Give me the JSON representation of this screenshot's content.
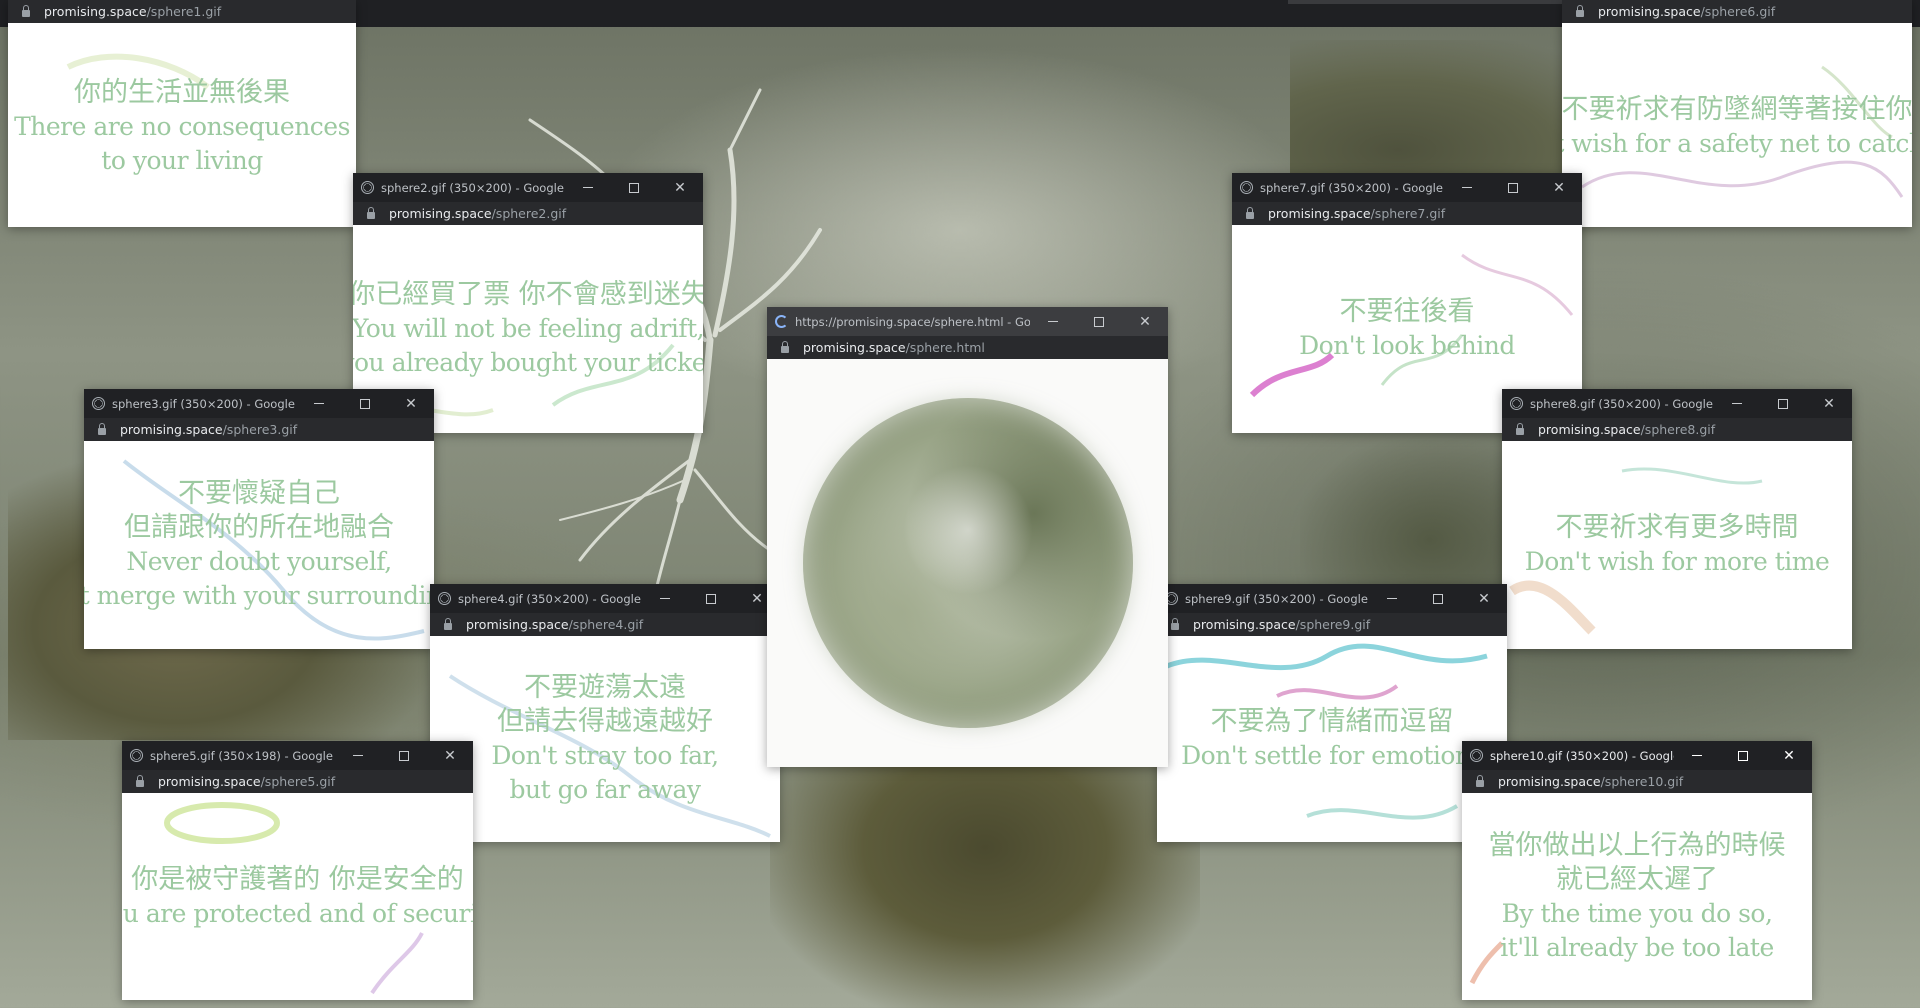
{
  "windows": [
    {
      "id": "sphere1",
      "title": "",
      "url_host": "promising.space",
      "url_path": "/sphere1.gif",
      "lines": [
        "你的生活並無後果",
        "There are no consequences",
        "to your living"
      ]
    },
    {
      "id": "sphere6",
      "title": "",
      "url_host": "promising.space",
      "url_path": "/sphere6.gif",
      "lines": [
        "不要祈求有防墜網等著接住你",
        "Don't wish for a safety net to catch you"
      ]
    },
    {
      "id": "sphere2",
      "title": "sphere2.gif (350×200) - Google C...",
      "url_host": "promising.space",
      "url_path": "/sphere2.gif",
      "lines": [
        "你已經買了票 你不會感到迷失",
        "You will not be feeling adrift,",
        "you already bought your ticket"
      ]
    },
    {
      "id": "sphere7",
      "title": "sphere7.gif (350×200) - Google C...",
      "url_host": "promising.space",
      "url_path": "/sphere7.gif",
      "lines": [
        "不要往後看",
        "Don't look behind"
      ]
    },
    {
      "id": "sphere3",
      "title": "sphere3.gif (350×200) - Google C...",
      "url_host": "promising.space",
      "url_path": "/sphere3.gif",
      "lines": [
        "不要懷疑自己",
        "但請跟你的所在地融合",
        "Never doubt yourself,",
        "but merge with your surroundings"
      ]
    },
    {
      "id": "sphere8",
      "title": "sphere8.gif (350×200) - Google C...",
      "url_host": "promising.space",
      "url_path": "/sphere8.gif",
      "lines": [
        "不要祈求有更多時間",
        "Don't wish for more time"
      ]
    },
    {
      "id": "sphere-main",
      "title": "https://promising.space/sphere.html - Goo...",
      "url_host": "promising.space",
      "url_path": "/sphere.html",
      "lines": []
    },
    {
      "id": "sphere4",
      "title": "sphere4.gif (350×200) - Google C...",
      "url_host": "promising.space",
      "url_path": "/sphere4.gif",
      "lines": [
        "不要遊蕩太遠",
        "但請去得越遠越好",
        "Don't stray too far,",
        "but go far away"
      ]
    },
    {
      "id": "sphere9",
      "title": "sphere9.gif (350×200) - Google C...",
      "url_host": "promising.space",
      "url_path": "/sphere9.gif",
      "lines": [
        "不要為了情緒而逗留",
        "Don't settle for emotions"
      ]
    },
    {
      "id": "sphere5",
      "title": "sphere5.gif (350×198) - Google C...",
      "url_host": "promising.space",
      "url_path": "/sphere5.gif",
      "lines": [
        "你是被守護著的 你是安全的",
        "You are protected and of security"
      ]
    },
    {
      "id": "sphere10",
      "title": "sphere10.gif (350×200) - Google...",
      "url_host": "promising.space",
      "url_path": "/sphere10.gif",
      "lines": [
        "當你做出以上行為的時候",
        "就已經太遲了",
        "By the time you do so,",
        "it'll already be too late"
      ]
    }
  ],
  "colors": {
    "text_green": "#9cc9a0",
    "titlebar": "#202124",
    "urlbar": "#292a2d"
  },
  "icons": {
    "tab_icon": "globe-icon",
    "loading_icon": "loading-spinner-icon",
    "lock": "lock-icon",
    "minimize": "minimize-icon",
    "maximize": "maximize-icon",
    "close": "close-icon"
  }
}
